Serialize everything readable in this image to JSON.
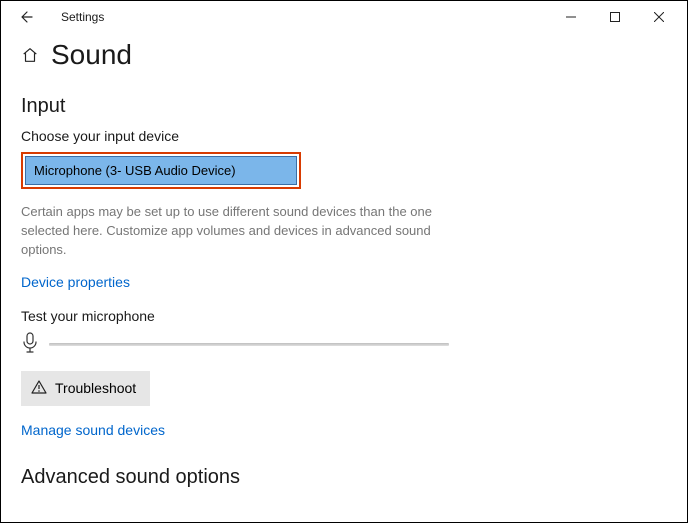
{
  "titlebar": {
    "title": "Settings"
  },
  "page": {
    "title": "Sound"
  },
  "input_section": {
    "heading": "Input",
    "choose_label": "Choose your input device",
    "selected_device": "Microphone (3- USB Audio Device)",
    "helper_text": "Certain apps may be set up to use different sound devices than the one selected here. Customize app volumes and devices in advanced sound options.",
    "device_properties_link": "Device properties",
    "test_label": "Test your microphone",
    "troubleshoot_label": "Troubleshoot",
    "manage_link": "Manage sound devices"
  },
  "advanced_section": {
    "heading": "Advanced sound options"
  }
}
